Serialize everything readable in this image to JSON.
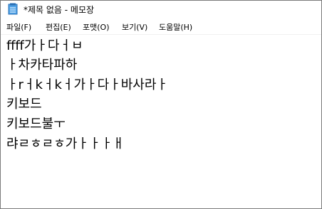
{
  "window": {
    "title": "*제목 없음 - 메모장",
    "icon": "notepad-icon"
  },
  "menu": {
    "items": [
      {
        "label": "파일(F)"
      },
      {
        "label": "편집(E)"
      },
      {
        "label": "포맷(O)"
      },
      {
        "label": "보기(V)"
      },
      {
        "label": "도움말(H)"
      }
    ]
  },
  "editor": {
    "lines": [
      "ffff가ㅏ다ㅓㅂ",
      "ㅏ차카타파하",
      "ㅏrㅓkㅓkㅓ가ㅏ다ㅏ바사라ㅏ",
      "키보드",
      "키보드불ㅜ",
      "랴ㄹㅎㄹㅎ가ㅏㅏㅏㅐ"
    ]
  }
}
